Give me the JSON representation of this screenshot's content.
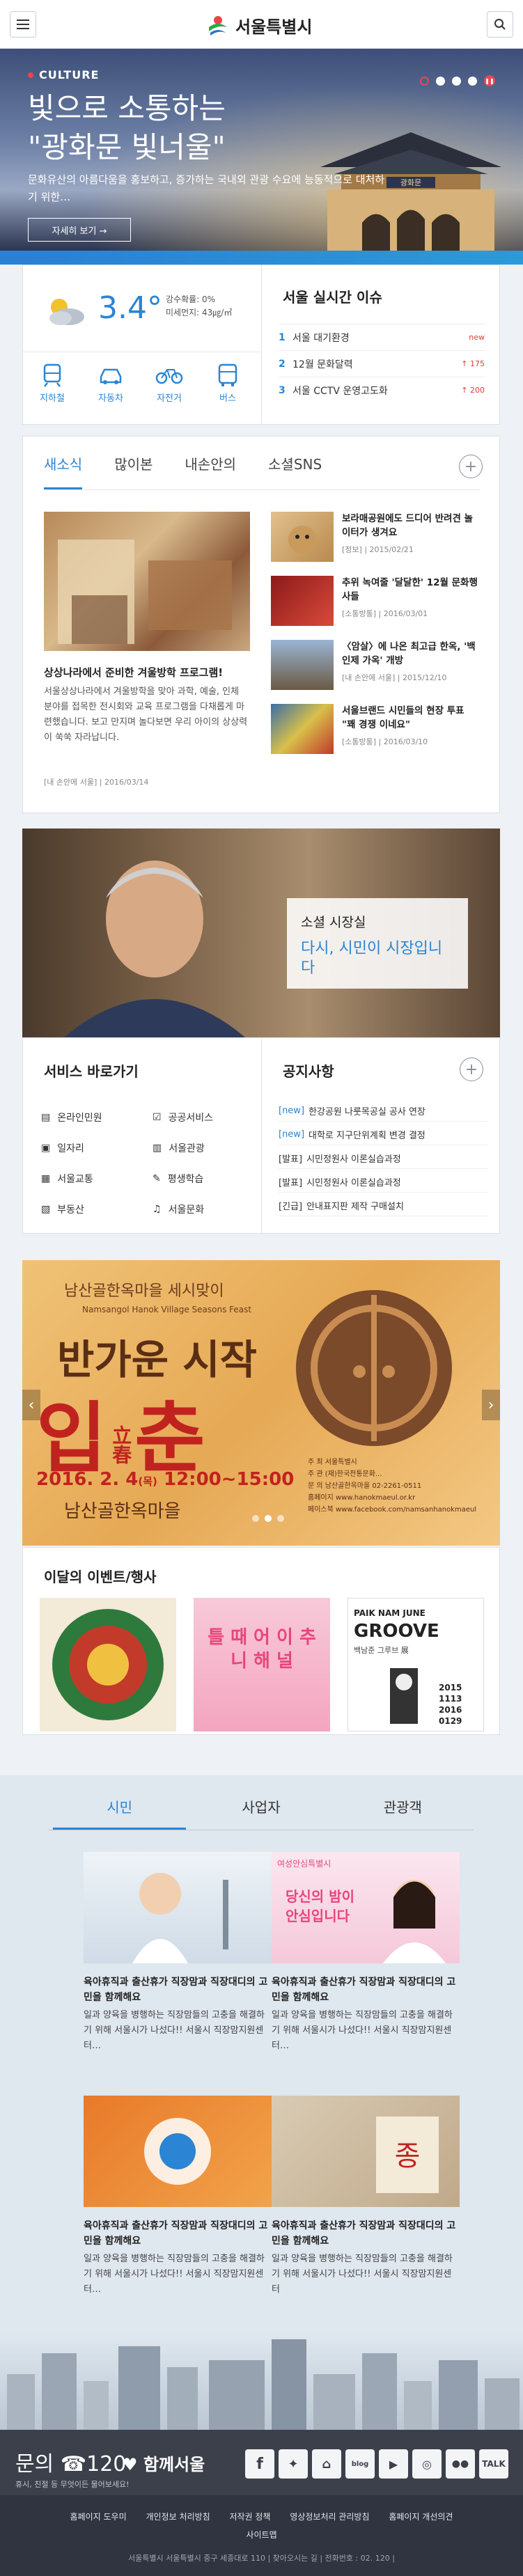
{
  "header": {
    "logo_text": "서울특별시",
    "menu_icon": "hamburger-menu-icon",
    "search_icon": "search-icon"
  },
  "hero": {
    "tag": "CULTURE",
    "title_line1": "빛으로 소통하는",
    "title_line2": "\"광화문 빛너울\"",
    "subtitle": "문화유산의 아름다움을 홍보하고, 증가하는 국내외 관광 수요에 능동적으로 대처하기 위한…",
    "more_label": "자세히 보기 →",
    "gate_sign": "광화문"
  },
  "weather": {
    "temperature": "3.4°",
    "precip_label": "강수확률: 0%",
    "dust_label": "미세먼지: 43㎍/㎥",
    "transport": [
      "지하철",
      "자동차",
      "자전거",
      "버스"
    ]
  },
  "issues": {
    "title": "서울 실시간 이슈",
    "items": [
      {
        "num": "1",
        "text": "서울 대기환경",
        "count": "new"
      },
      {
        "num": "2",
        "text": "12월 문화달력",
        "count": "↑ 175"
      },
      {
        "num": "3",
        "text": "서울 CCTV 운영고도화",
        "count": "↑ 200"
      }
    ]
  },
  "news": {
    "tabs": [
      "새소식",
      "많이본",
      "내손안의",
      "소셜SNS"
    ],
    "lead": {
      "title": "상상나라에서 준비한 겨울방학 프로그램!",
      "body": "서울상상나라에서 겨울방학을 맞아 과학, 예술, 인체 분야를 접목한 전시회와 교육 프로그램을 다채롭게 마련했습니다. 보고 만지며 놀다보면 우리 아이의 상상력이 쑥쑥 자라납니다.",
      "meta": "[내 손안에 서울]  |  2016/03/14"
    },
    "side": [
      {
        "title": "보라매공원에도 드디어 반려견 놀이터가 생겨요",
        "meta": "[정보]  |  2015/02/21"
      },
      {
        "title": "추위 녹여줄 '달달한' 12월 문화행사들",
        "meta": "[소통방통]  |  2016/03/01"
      },
      {
        "title": "〈암살〉에 나온 최고급 한옥, '백인제 가옥' 개방",
        "meta": "[내 손안에 서울]  |  2015/12/10"
      },
      {
        "title": "서울브랜드 시민들의 현장 투표 \"꽤 경쟁 이네요\"",
        "meta": "[소통방통]  |  2016/03/10"
      }
    ]
  },
  "mayor": {
    "title": "소셜 시장실",
    "subtitle": "다시, 시민이 시장입니다"
  },
  "services": {
    "title": "서비스 바로가기",
    "items": [
      {
        "label": "온라인민원",
        "icon": "document-icon"
      },
      {
        "label": "공공서비스",
        "icon": "checklist-icon"
      },
      {
        "label": "일자리",
        "icon": "briefcase-icon"
      },
      {
        "label": "서울관광",
        "icon": "map-icon"
      },
      {
        "label": "서울교통",
        "icon": "bus-icon"
      },
      {
        "label": "평생학습",
        "icon": "graduation-icon"
      },
      {
        "label": "부동산",
        "icon": "building-icon"
      },
      {
        "label": "서울문화",
        "icon": "music-icon"
      }
    ]
  },
  "notice": {
    "title": "공지사항",
    "items": [
      {
        "tag": "[new]",
        "text": "한강공원 나룻목공실 공사 연장"
      },
      {
        "tag": "[new]",
        "text": "대학로 지구단위계획 변경 결정"
      },
      {
        "tag": "[발표]",
        "text": "시민정원사 이론실습과정"
      },
      {
        "tag": "[발표]",
        "text": "시민정원사 이론실습과정"
      },
      {
        "tag": "[긴급]",
        "text": "안내표지판 제작 구매설치"
      }
    ]
  },
  "banner": {
    "line1": "남산골한옥마을 세시맞이",
    "line2": "Namsangol Hanok Village Seasons Feast",
    "line3": "반가운 시작",
    "line4a": "입",
    "line4b": "立春",
    "line4c": "춘",
    "date": "2016. 2. 4",
    "date_day": "(목)",
    "time": "12:00~15:00",
    "place": "남산골한옥마을",
    "info": [
      "주  최   서울특별시",
      "주  관   (재)한국전통문화...",
      "문  의   남산골한옥마을 02-2261-0511",
      "홈페이지  www.hanokmaeul.or.kr",
      "페이스북  www.facebook.com/namsanhanokmaeul"
    ]
  },
  "events": {
    "title": "이달의 이벤트/행사",
    "poster3_title": "PAIK NAM JUNE",
    "poster3_sub": "GROOVE",
    "poster3_ko": "백남준 그루브 展",
    "poster3_dates": "2015 1113 2016 0129",
    "poster2_text": "틀 때 어 이 추 니 해 널"
  },
  "audience": {
    "tabs": [
      "시민",
      "사업자",
      "관광객"
    ],
    "badge_text": "여성안심특별시",
    "badge_quote": "당신의 밤이 안심입니다",
    "cards": [
      {
        "title": "육아휴직과 출산휴가 직장맘과 직장대디의 고민을 함께해요",
        "body": "일과 양육을 병행하는 직장맘들의 고충을 해결하기 위해 서울시가 나섰다!! 서울시 직장맘지원센터…"
      },
      {
        "title": "육아휴직과 출산휴가 직장맘과 직장대디의 고민을 함께해요",
        "body": "일과 양육을 병행하는 직장맘들의 고충을 해결하기 위해 서울시가 나섰다!! 서울시 직장맘지원센터…"
      },
      {
        "title": "육아휴직과 출산휴가 직장맘과 직장대디의 고민을 함께해요",
        "body": "일과 양육을 병행하는 직장맘들의 고충을 해결하기 위해 서울시가 나섰다!! 서울시 직장맘지원센터…"
      },
      {
        "title": "육아휴직과 출산휴가 직장맘과 직장대디의 고민을 함께해요",
        "body": "일과 양육을 병행하는 직장맘들의 고충을 해결하기 위해 서울시가 나섰다!! 서울시 직장맘지원센터"
      }
    ]
  },
  "footer": {
    "call_label": "문의 ☎120",
    "call_sub": "휴시, 친절 등 무엇이든 물어보세요!",
    "logo": "함께서울",
    "links": [
      "홈페이지 도우미",
      "개인정보 처리방침",
      "저작권 정책",
      "영상정보처리 관리방침",
      "홈페이지 개선의견",
      "사이트맵"
    ],
    "address": "서울특별시 서울특별시 중구 세종대로 110  |  찾아오시는 길  |  전화번호 : 02. 120  |"
  },
  "colors": {
    "accent": "#2b84d4",
    "alert": "#e03a3a",
    "footer_bg": "#2f3440"
  }
}
